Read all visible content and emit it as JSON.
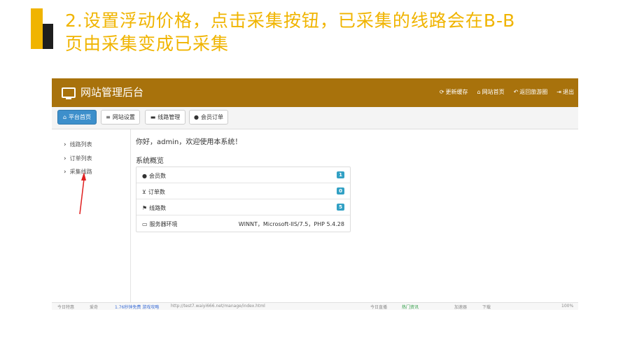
{
  "slide": {
    "title_line1": "2.设置浮动价格，点击采集按钮，已采集的线路会在B-B",
    "title_line2": "页由采集变成已采集",
    "accent_color": "#f0b400"
  },
  "admin": {
    "title": "网站管理后台",
    "topbar_color": "#a8720c",
    "top_links": [
      {
        "icon": "refresh-icon",
        "label": "更新缓存"
      },
      {
        "icon": "home-icon",
        "label": "网站首页"
      },
      {
        "icon": "back-icon",
        "label": "返回旅游圈"
      },
      {
        "icon": "logout-icon",
        "label": "退出"
      }
    ],
    "nav_tabs": [
      {
        "icon": "home-icon",
        "label": "平台首页",
        "active": true
      },
      {
        "icon": "list-icon",
        "label": "网站设置"
      },
      {
        "icon": "folder-icon",
        "label": "线路管理"
      },
      {
        "icon": "user-icon",
        "label": "会员订单"
      }
    ],
    "sidebar": [
      {
        "label": "线路列表"
      },
      {
        "label": "订单列表"
      },
      {
        "label": "采集线路"
      }
    ],
    "welcome": "你好，admin，欢迎使用本系统！",
    "overview_title": "系统概览",
    "overview_rows": [
      {
        "icon": "user-icon",
        "label": "会员数",
        "badge": "1"
      },
      {
        "icon": "cart-icon",
        "label": "订单数",
        "badge": "0"
      },
      {
        "icon": "flag-icon",
        "label": "线路数",
        "badge": "5"
      },
      {
        "icon": "monitor-icon",
        "label": "服务器环境",
        "value": "WINNT，Microsoft-IIS/7.5，PHP 5.4.28"
      }
    ]
  },
  "statusbar": {
    "left1": "今日特惠",
    "left2": "爱奇",
    "left3": "1.76秒钟免费 游戏攻略",
    "url": "http://test7.waiyi666.net/manage/index.html",
    "right1": "今日直播",
    "right2": "热门资讯",
    "right3": "加速器",
    "right4": "下载",
    "zoom": "100%"
  }
}
